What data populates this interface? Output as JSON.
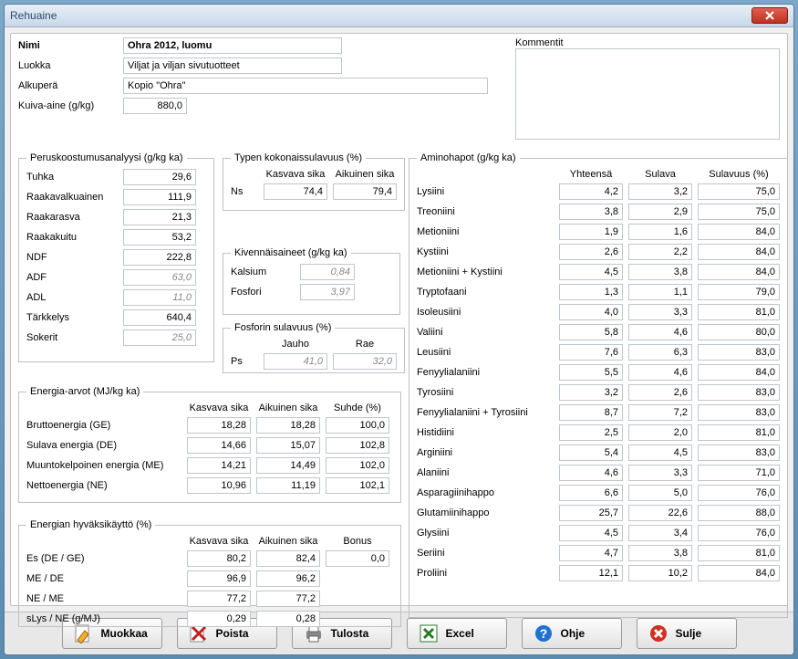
{
  "window": {
    "title": "Rehuaine"
  },
  "top": {
    "nimi_label": "Nimi",
    "nimi_value": "Ohra 2012, luomu",
    "luokka_label": "Luokka",
    "luokka_value": "Viljat ja viljan sivutuotteet",
    "alkupera_label": "Alkuperä",
    "alkupera_value": "Kopio \"Ohra\"",
    "kuiva_label": "Kuiva-aine (g/kg)",
    "kuiva_value": "880,0",
    "kommentit_label": "Kommentit",
    "kommentit_value": ""
  },
  "perus": {
    "legend": "Peruskoostumusanalyysi (g/kg ka)",
    "rows": [
      {
        "label": "Tuhka",
        "value": "29,6",
        "dim": false
      },
      {
        "label": "Raakavalkuainen",
        "value": "111,9",
        "dim": false
      },
      {
        "label": "Raakarasva",
        "value": "21,3",
        "dim": false
      },
      {
        "label": "Raakakuitu",
        "value": "53,2",
        "dim": false
      },
      {
        "label": "NDF",
        "value": "222,8",
        "dim": false
      },
      {
        "label": "ADF",
        "value": "63,0",
        "dim": true
      },
      {
        "label": "ADL",
        "value": "11,0",
        "dim": true
      },
      {
        "label": "Tärkkelys",
        "value": "640,4",
        "dim": false
      },
      {
        "label": "Sokerit",
        "value": "25,0",
        "dim": true
      }
    ]
  },
  "typen": {
    "legend": "Typen kokonaissulavuus (%)",
    "col1": "Kasvava sika",
    "col2": "Aikuinen sika",
    "label": "Ns",
    "v1": "74,4",
    "v2": "79,4"
  },
  "kiven": {
    "legend": "Kivennäisaineet (g/kg ka)",
    "rows": [
      {
        "label": "Kalsium",
        "value": "0,84",
        "dim": true
      },
      {
        "label": "Fosfori",
        "value": "3,97",
        "dim": true
      }
    ]
  },
  "fosfo": {
    "legend": "Fosforin sulavuus (%)",
    "col1": "Jauho",
    "col2": "Rae",
    "label": "Ps",
    "v1": "41,0",
    "v2": "32,0",
    "dim": true
  },
  "energ": {
    "legend": "Energia-arvot (MJ/kg ka)",
    "col1": "Kasvava sika",
    "col2": "Aikuinen sika",
    "col3": "Suhde (%)",
    "rows": [
      {
        "label": "Bruttoenergia (GE)",
        "v1": "18,28",
        "v2": "18,28",
        "v3": "100,0"
      },
      {
        "label": "Sulava energia (DE)",
        "v1": "14,66",
        "v2": "15,07",
        "v3": "102,8"
      },
      {
        "label": "Muuntokelpoinen energia (ME)",
        "v1": "14,21",
        "v2": "14,49",
        "v3": "102,0"
      },
      {
        "label": "Nettoenergia (NE)",
        "v1": "10,96",
        "v2": "11,19",
        "v3": "102,1"
      }
    ]
  },
  "hyvak": {
    "legend": "Energian hyväksikäyttö (%)",
    "col1": "Kasvava sika",
    "col2": "Aikuinen sika",
    "col3": "Bonus",
    "rows": [
      {
        "label": "Es (DE / GE)",
        "v1": "80,2",
        "v2": "82,4",
        "v3": "0,0"
      },
      {
        "label": "ME / DE",
        "v1": "96,9",
        "v2": "96,2",
        "v3": ""
      },
      {
        "label": "NE / ME",
        "v1": "77,2",
        "v2": "77,2",
        "v3": ""
      },
      {
        "label": "sLys / NE (g/MJ)",
        "v1": "0,29",
        "v2": "0,28",
        "v3": ""
      }
    ]
  },
  "amino": {
    "legend": "Aminohapot (g/kg ka)",
    "col1": "Yhteensä",
    "col2": "Sulava",
    "col3": "Sulavuus (%)",
    "rows": [
      {
        "label": "Lysiini",
        "v1": "4,2",
        "v2": "3,2",
        "v3": "75,0"
      },
      {
        "label": "Treoniini",
        "v1": "3,8",
        "v2": "2,9",
        "v3": "75,0"
      },
      {
        "label": "Metioniini",
        "v1": "1,9",
        "v2": "1,6",
        "v3": "84,0"
      },
      {
        "label": "Kystiini",
        "v1": "2,6",
        "v2": "2,2",
        "v3": "84,0"
      },
      {
        "label": "Metioniini + Kystiini",
        "v1": "4,5",
        "v2": "3,8",
        "v3": "84,0"
      },
      {
        "label": "Tryptofaani",
        "v1": "1,3",
        "v2": "1,1",
        "v3": "79,0"
      },
      {
        "label": "Isoleusiini",
        "v1": "4,0",
        "v2": "3,3",
        "v3": "81,0"
      },
      {
        "label": "Valiini",
        "v1": "5,8",
        "v2": "4,6",
        "v3": "80,0"
      },
      {
        "label": "Leusiini",
        "v1": "7,6",
        "v2": "6,3",
        "v3": "83,0"
      },
      {
        "label": "Fenyylialaniini",
        "v1": "5,5",
        "v2": "4,6",
        "v3": "84,0"
      },
      {
        "label": "Tyrosiini",
        "v1": "3,2",
        "v2": "2,6",
        "v3": "83,0"
      },
      {
        "label": "Fenyylialaniini + Tyrosiini",
        "v1": "8,7",
        "v2": "7,2",
        "v3": "83,0"
      },
      {
        "label": "Histidiini",
        "v1": "2,5",
        "v2": "2,0",
        "v3": "81,0"
      },
      {
        "label": "Arginiini",
        "v1": "5,4",
        "v2": "4,5",
        "v3": "83,0"
      },
      {
        "label": "Alaniini",
        "v1": "4,6",
        "v2": "3,3",
        "v3": "71,0"
      },
      {
        "label": "Asparagiinihappo",
        "v1": "6,6",
        "v2": "5,0",
        "v3": "76,0"
      },
      {
        "label": "Glutamiinihappo",
        "v1": "25,7",
        "v2": "22,6",
        "v3": "88,0"
      },
      {
        "label": "Glysiini",
        "v1": "4,5",
        "v2": "3,4",
        "v3": "76,0"
      },
      {
        "label": "Seriini",
        "v1": "4,7",
        "v2": "3,8",
        "v3": "81,0"
      },
      {
        "label": "Proliini",
        "v1": "12,1",
        "v2": "10,2",
        "v3": "84,0"
      }
    ]
  },
  "footer": {
    "muokkaa": "Muokkaa",
    "poista": "Poista",
    "tulosta": "Tulosta",
    "excel": "Excel",
    "ohje": "Ohje",
    "sulje": "Sulje"
  }
}
